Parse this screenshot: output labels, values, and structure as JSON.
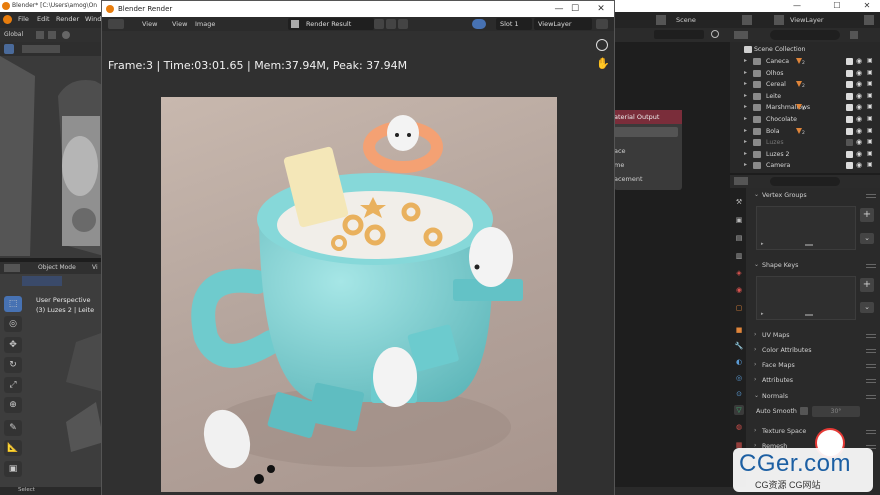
{
  "main_window": {
    "title": "Blender* [C:\\Users\\amog\\On",
    "menu": [
      "File",
      "Edit",
      "Render",
      "Wind"
    ],
    "win_controls": [
      "—",
      "☐",
      "✕"
    ]
  },
  "viewport": {
    "orientation": "Global",
    "mode": "Object Mode",
    "view_menu": "Vi",
    "perspective": "User Perspective",
    "context": "(3) Luzes 2 | Leite"
  },
  "render_window": {
    "title": "Blender Render",
    "controls": [
      "—",
      "☐",
      "✕"
    ],
    "menu_view": "View",
    "menu_view2": "View",
    "menu_image": "Image",
    "image_name": "Render Result",
    "slot": "Slot 1",
    "view_layer": "ViewLayer",
    "info": "Frame:3 | Time:03:01.65 | Mem:37.94M, Peak: 37.94M"
  },
  "top_right": {
    "scene": "Scene",
    "view_layer": "ViewLayer"
  },
  "outliner": {
    "root": "Scene Collection",
    "items": [
      {
        "label": "Caneca",
        "badge": "2",
        "enabled": true
      },
      {
        "label": "Olhos",
        "badge": "",
        "enabled": true
      },
      {
        "label": "Cereal",
        "badge": "2",
        "enabled": true
      },
      {
        "label": "Leite",
        "badge": "",
        "enabled": true
      },
      {
        "label": "Marshmallows",
        "badge": "4",
        "enabled": true
      },
      {
        "label": "Chocolate",
        "badge": "",
        "enabled": true
      },
      {
        "label": "Bola",
        "badge": "2",
        "enabled": true
      },
      {
        "label": "Luzes",
        "badge": "",
        "enabled": false
      },
      {
        "label": "Luzes 2",
        "badge": "",
        "enabled": true
      },
      {
        "label": "Camera",
        "badge": "",
        "enabled": true
      }
    ]
  },
  "node_editor": {
    "material_output": "aterial Output",
    "options": [
      "ace",
      "me",
      "acement"
    ]
  },
  "properties": {
    "sections": [
      "Vertex Groups",
      "Shape Keys",
      "UV Maps",
      "Color Attributes",
      "Face Maps",
      "Attributes",
      "Normals",
      "Texture Space",
      "Remesh"
    ],
    "auto_smooth_label": "Auto Smooth",
    "auto_smooth_angle": "30°"
  },
  "status_bar": {
    "select": "Select"
  },
  "watermark": {
    "big": "CGer.com",
    "small": "CG资源 CG网站"
  },
  "colors": {
    "accent": "#e87d0d",
    "mug": "#7fd2d3",
    "background_render": "#b8a8a0"
  }
}
